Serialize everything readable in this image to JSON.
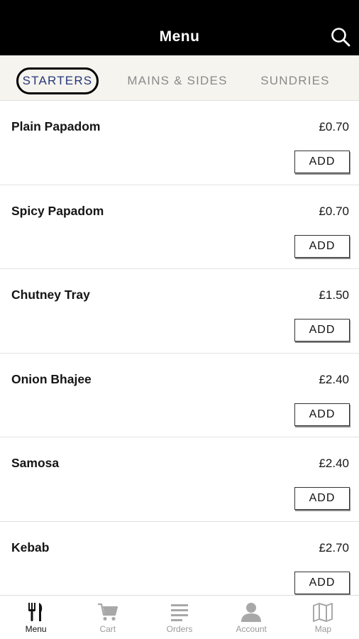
{
  "header": {
    "title": "Menu",
    "search_icon": "search-icon"
  },
  "tabs": [
    {
      "label": "STARTERS",
      "active": true
    },
    {
      "label": "MAINS & SIDES",
      "active": false
    },
    {
      "label": "SUNDRIES",
      "active": false
    }
  ],
  "items": [
    {
      "name": "Plain Papadom",
      "price": "£0.70",
      "add_label": "ADD"
    },
    {
      "name": "Spicy Papadom",
      "price": "£0.70",
      "add_label": "ADD"
    },
    {
      "name": "Chutney Tray",
      "price": "£1.50",
      "add_label": "ADD"
    },
    {
      "name": "Onion Bhajee",
      "price": "£2.40",
      "add_label": "ADD"
    },
    {
      "name": "Samosa",
      "price": "£2.40",
      "add_label": "ADD"
    },
    {
      "name": "Kebab",
      "price": "£2.70",
      "add_label": "ADD"
    }
  ],
  "bottom_nav": [
    {
      "label": "Menu",
      "icon": "cutlery-icon",
      "active": true
    },
    {
      "label": "Cart",
      "icon": "cart-icon",
      "active": false
    },
    {
      "label": "Orders",
      "icon": "list-icon",
      "active": false
    },
    {
      "label": "Account",
      "icon": "user-icon",
      "active": false
    },
    {
      "label": "Map",
      "icon": "map-icon",
      "active": false
    }
  ],
  "colors": {
    "header_bg": "#000000",
    "active_tab_text": "#26377a",
    "tab_bar_bg": "#f5f4ee"
  }
}
